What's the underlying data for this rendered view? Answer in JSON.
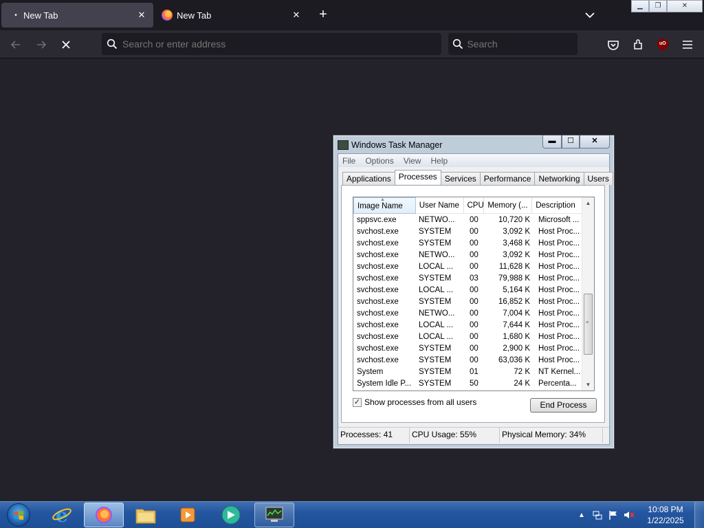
{
  "browser": {
    "tabs": [
      {
        "title": "New Tab",
        "close": "✕"
      },
      {
        "title": "New Tab",
        "close": "✕"
      }
    ],
    "new_tab_glyph": "+",
    "address_placeholder": "Search or enter address",
    "search_placeholder": "Search",
    "icons": [
      "back-arrow-icon",
      "forward-arrow-icon",
      "stop-icon",
      "search-icon",
      "pocket-icon",
      "extensions-icon",
      "ublock-icon",
      "hamburger-menu-icon",
      "chevron-down-icon"
    ],
    "ublock_badge": "uO"
  },
  "task_manager": {
    "title": "Windows Task Manager",
    "menu": [
      "File",
      "Options",
      "View",
      "Help"
    ],
    "tabs": [
      "Applications",
      "Processes",
      "Services",
      "Performance",
      "Networking",
      "Users"
    ],
    "active_tab": "Processes",
    "columns": [
      "Image Name",
      "User Name",
      "CPU",
      "Memory (...",
      "Description"
    ],
    "processes": [
      {
        "name": "sppsvc.exe",
        "user": "NETWO...",
        "cpu": "00",
        "mem": "10,720 K",
        "desc": "Microsoft ..."
      },
      {
        "name": "svchost.exe",
        "user": "SYSTEM",
        "cpu": "00",
        "mem": "3,092 K",
        "desc": "Host Proc..."
      },
      {
        "name": "svchost.exe",
        "user": "SYSTEM",
        "cpu": "00",
        "mem": "3,468 K",
        "desc": "Host Proc..."
      },
      {
        "name": "svchost.exe",
        "user": "NETWO...",
        "cpu": "00",
        "mem": "3,092 K",
        "desc": "Host Proc..."
      },
      {
        "name": "svchost.exe",
        "user": "LOCAL ...",
        "cpu": "00",
        "mem": "11,628 K",
        "desc": "Host Proc..."
      },
      {
        "name": "svchost.exe",
        "user": "SYSTEM",
        "cpu": "03",
        "mem": "79,988 K",
        "desc": "Host Proc..."
      },
      {
        "name": "svchost.exe",
        "user": "LOCAL ...",
        "cpu": "00",
        "mem": "5,164 K",
        "desc": "Host Proc..."
      },
      {
        "name": "svchost.exe",
        "user": "SYSTEM",
        "cpu": "00",
        "mem": "16,852 K",
        "desc": "Host Proc..."
      },
      {
        "name": "svchost.exe",
        "user": "NETWO...",
        "cpu": "00",
        "mem": "7,004 K",
        "desc": "Host Proc..."
      },
      {
        "name": "svchost.exe",
        "user": "LOCAL ...",
        "cpu": "00",
        "mem": "7,644 K",
        "desc": "Host Proc..."
      },
      {
        "name": "svchost.exe",
        "user": "LOCAL ...",
        "cpu": "00",
        "mem": "1,680 K",
        "desc": "Host Proc..."
      },
      {
        "name": "svchost.exe",
        "user": "SYSTEM",
        "cpu": "00",
        "mem": "2,900 K",
        "desc": "Host Proc..."
      },
      {
        "name": "svchost.exe",
        "user": "SYSTEM",
        "cpu": "00",
        "mem": "63,036 K",
        "desc": "Host Proc..."
      },
      {
        "name": "System",
        "user": "SYSTEM",
        "cpu": "01",
        "mem": "72 K",
        "desc": "NT Kernel..."
      },
      {
        "name": "System Idle P...",
        "user": "SYSTEM",
        "cpu": "50",
        "mem": "24 K",
        "desc": "Percenta..."
      }
    ],
    "show_all_label": "Show processes from all users",
    "show_all_checked": "✓",
    "end_process_label": "End Process",
    "status": {
      "processes": "Processes: 41",
      "cpu": "CPU Usage: 55%",
      "memory": "Physical Memory: 34%"
    }
  },
  "taskbar": {
    "apps": [
      "internet-explorer",
      "firefox",
      "file-explorer",
      "media-player",
      "app-green",
      "task-manager"
    ],
    "time": "10:08 PM",
    "date": "1/22/2025",
    "tray_icons": [
      "show-hidden-icons",
      "network-icon",
      "action-center-flag-icon",
      "volume-muted-icon"
    ]
  },
  "colors": {
    "browser_bg": "#23222b",
    "taskbar_blue": "#2456a0",
    "firefox_orange": "#ff7139"
  }
}
